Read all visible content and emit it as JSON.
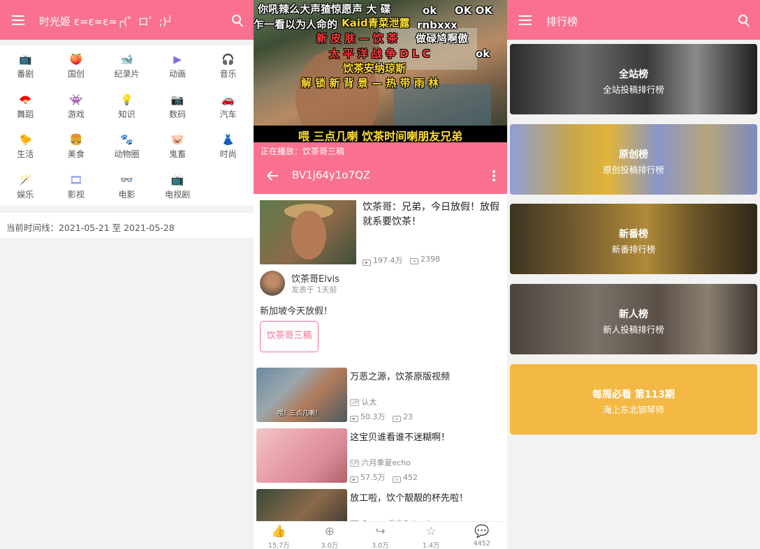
{
  "panel_home": {
    "title": "时光姬 ε=ε=ε=┌(゜ロ゜;)┘",
    "categories": [
      {
        "label": "番剧",
        "icon": "tv-icon",
        "glyph": "📺"
      },
      {
        "label": "国创",
        "icon": "peach-icon",
        "glyph": "🍑"
      },
      {
        "label": "纪录片",
        "icon": "whale-icon",
        "glyph": "🐋"
      },
      {
        "label": "动画",
        "icon": "play-icon",
        "glyph": "▶"
      },
      {
        "label": "音乐",
        "icon": "headphones-icon",
        "glyph": "🎧"
      },
      {
        "label": "舞蹈",
        "icon": "fan-icon",
        "glyph": "🪭"
      },
      {
        "label": "游戏",
        "icon": "creeper-icon",
        "glyph": "👾"
      },
      {
        "label": "知识",
        "icon": "bulb-icon",
        "glyph": "💡"
      },
      {
        "label": "数码",
        "icon": "camera-icon",
        "glyph": "📷"
      },
      {
        "label": "汽车",
        "icon": "car-icon",
        "glyph": "🚗"
      },
      {
        "label": "生活",
        "icon": "duck-icon",
        "glyph": "🐤"
      },
      {
        "label": "美食",
        "icon": "bun-icon",
        "glyph": "🍔"
      },
      {
        "label": "动物圈",
        "icon": "paw-icon",
        "glyph": "🐾"
      },
      {
        "label": "鬼畜",
        "icon": "ghost-face-icon",
        "glyph": "🐷"
      },
      {
        "label": "时尚",
        "icon": "dress-icon",
        "glyph": "👗"
      },
      {
        "label": "娱乐",
        "icon": "star-wand-icon",
        "glyph": "🪄"
      },
      {
        "label": "影视",
        "icon": "film-icon",
        "glyph": "🎞"
      },
      {
        "label": "电影",
        "icon": "3d-glasses-icon",
        "glyph": "👓"
      },
      {
        "label": "电视剧",
        "icon": "tv-set-icon",
        "glyph": "📺"
      }
    ],
    "timeline": "当前时间线：2021-05-21 至 2021-05-28"
  },
  "panel_video": {
    "danmaku": [
      {
        "text": "你吼辣么大声猹惊愿声 大 碟",
        "color": "#ffffff"
      },
      {
        "text": "ok",
        "color": "#ffffff"
      },
      {
        "text": "OK OK",
        "color": "#ffffff"
      },
      {
        "text": "乍一看以为人命的",
        "color": "#ffffff"
      },
      {
        "text": "Kaid青菜泄露",
        "color": "#ffde2f"
      },
      {
        "text": "rnbxxx",
        "color": "#ffffff"
      },
      {
        "text": "新 皮 肤 — 饮 茶",
        "color": "#ff3d3d"
      },
      {
        "text": "做碌鸠啊傲",
        "color": "#ffffff"
      },
      {
        "text": "太 平 洋 战 争 D L C",
        "color": "#ff3d3d"
      },
      {
        "text": "ok",
        "color": "#ffffff"
      },
      {
        "text": "饮茶安纳琼斯",
        "color": "#ffde2f"
      },
      {
        "text": "解 锁 新 背 景 — 热 带 雨 林",
        "color": "#ffde2f"
      }
    ],
    "subtitle": "喂 三点几喇 饮茶时间喇朋友兄弟",
    "now_playing": "正在播放：饮茶哥三稿",
    "bvid": "BV1j64y1o7QZ",
    "title": "饮茶哥：兄弟，今日放假！放假就系要饮茶！",
    "views": "197.4万",
    "danmaku_count": "2398",
    "up_name": "饮茶哥Elvis",
    "published": "发表于 1天前",
    "description": "新加坡今天放假！",
    "tag": "饮茶哥三稿",
    "related": [
      {
        "title": "万恶之源，饮茶原版视频",
        "up": "认太",
        "views": "50.3万",
        "danmaku": "23",
        "thumb_text": "喂！三点几喇！"
      },
      {
        "title": "这宝贝谁看谁不迷糊啊！",
        "up": "六月季夏echo",
        "views": "57.5万",
        "danmaku": "452",
        "thumb_text": ""
      },
      {
        "title": "放工啦，饮个靓靓的杯先啦！",
        "up": "Caesar中文Salomi",
        "views": "",
        "danmaku": "",
        "thumb_text": ""
      }
    ],
    "bottom_bar": [
      {
        "icon": "like-icon",
        "glyph": "👍",
        "count": "15.7万"
      },
      {
        "icon": "coin-icon",
        "glyph": "⊕",
        "count": "3.0万"
      },
      {
        "icon": "share-icon",
        "glyph": "↪",
        "count": "3.0万"
      },
      {
        "icon": "favorite-icon",
        "glyph": "☆",
        "count": "1.4万"
      },
      {
        "icon": "comment-icon",
        "glyph": "💬",
        "count": "4452"
      }
    ]
  },
  "panel_rank": {
    "title": "排行榜",
    "cards": [
      {
        "title": "全站榜",
        "subtitle": "全站投稿排行榜",
        "bg": "linear-gradient(90deg,#2c2c2c,#6b6b6b 30%,#3a3a3a 55%,#8a8a8a 75%,#1f1f1f)"
      },
      {
        "title": "原创榜",
        "subtitle": "原创投稿排行榜",
        "bg": "linear-gradient(90deg,#8f9ed6,#c9a64a 25%,#e0b53c 40%,#8895c8 60%,#b7a57c 80%,#7b8ac0)"
      },
      {
        "title": "新番榜",
        "subtitle": "新番排行榜",
        "bg": "linear-gradient(90deg,#3e3422,#7a6030 30%,#b08a3a 55%,#6a5428 75%,#2e2718)"
      },
      {
        "title": "新人榜",
        "subtitle": "新人投稿排行榜",
        "bg": "linear-gradient(90deg,#4a443c,#7a7268 35%,#5a5048 60%,#8a8070 80%,#3c3630)"
      },
      {
        "title": "每周必看 第113期",
        "subtitle": "海上东北钢琴师",
        "bg": "#f3b944"
      }
    ]
  }
}
